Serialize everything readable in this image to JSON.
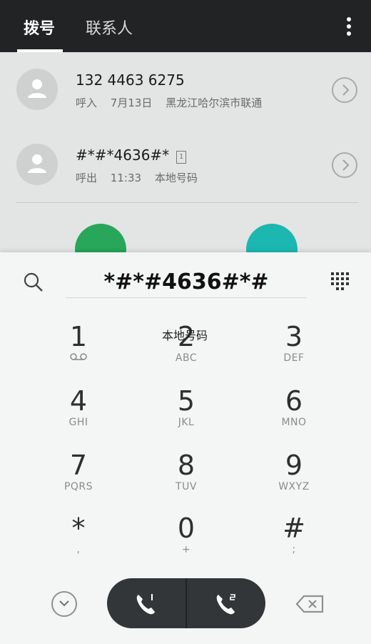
{
  "tabs": {
    "dial": "拨号",
    "contacts": "联系人"
  },
  "call_log": [
    {
      "number": "132 4463 6275",
      "direction": "呼入",
      "time": "7月13日",
      "location": "黑龙江哈尔滨市联通",
      "sim": ""
    },
    {
      "number": "#*#*4636#*",
      "direction": "呼出",
      "time": "11:33",
      "location": "本地号码",
      "sim": "1"
    }
  ],
  "dialpad": {
    "input_value": "*#*#4636#*#",
    "location_hint": "本地号码",
    "keys": [
      {
        "num": "1",
        "letters": ""
      },
      {
        "num": "2",
        "letters": "ABC"
      },
      {
        "num": "3",
        "letters": "DEF"
      },
      {
        "num": "4",
        "letters": "GHI"
      },
      {
        "num": "5",
        "letters": "JKL"
      },
      {
        "num": "6",
        "letters": "MNO"
      },
      {
        "num": "7",
        "letters": "PQRS"
      },
      {
        "num": "8",
        "letters": "TUV"
      },
      {
        "num": "9",
        "letters": "WXYZ"
      },
      {
        "num": "*",
        "letters": ","
      },
      {
        "num": "0",
        "letters": "+"
      },
      {
        "num": "#",
        "letters": ";"
      }
    ]
  },
  "colors": {
    "topbar": "#212325",
    "call_fab": "#28a65a",
    "message_fab": "#1cb7b1",
    "call_pill": "#333639"
  },
  "icons": [
    "overflow-menu-icon",
    "avatar-placeholder-icon",
    "chevron-right-icon",
    "search-icon",
    "dialpad-grid-icon",
    "voicemail-icon",
    "collapse-icon",
    "phone-sim1-icon",
    "phone-sim2-icon",
    "backspace-icon"
  ]
}
